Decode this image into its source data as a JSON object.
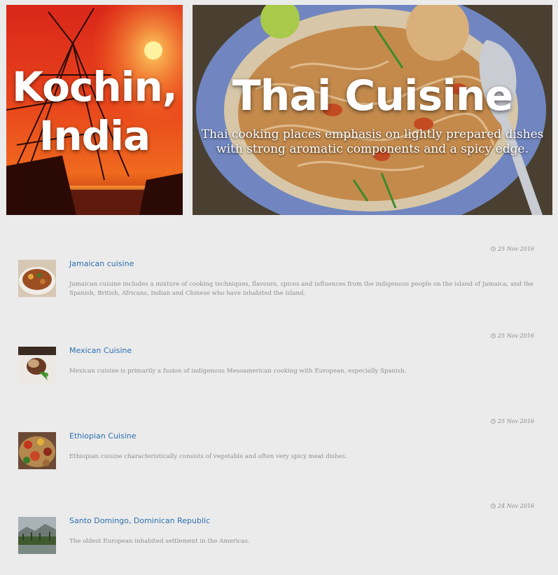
{
  "heroes": {
    "kochin": {
      "title": "Kochin, India"
    },
    "thai": {
      "title": "Thai Cuisine",
      "description": "Thai cooking places emphasis on lightly prepared dishes with strong aromatic components and a spicy edge."
    }
  },
  "articles": [
    {
      "title": "Jamaican cuisine",
      "date": "25 Nov 2016",
      "summary": "Jamaican cuisine includes a mixture of cooking techniques, flavours, spices and influences from the indigenous people on the island of Jamaica, and the Spanish, British, Africans, Indian and Chinese who have inhabited the island.",
      "thumbnail": "jamaican-soup-thumbnail"
    },
    {
      "title": "Mexican Cuisine",
      "date": "25 Nov 2016",
      "summary": "Mexican cuisine is primarily a fusion of indigenous Mesoamerican cooking with European, especially Spanish.",
      "thumbnail": "mexican-dish-thumbnail"
    },
    {
      "title": "Ethiopian Cuisine",
      "date": "25 Nov 2016",
      "summary": "Ethiopian cuisine characteristically consists of vegetable and often very spicy meat dishes.",
      "thumbnail": "ethiopian-platter-thumbnail"
    },
    {
      "title": "Santo Domingo, Dominican Republic",
      "date": "24 Nov 2016",
      "summary": "The oldest European inhabited settlement in the Americas.",
      "thumbnail": "santo-domingo-landscape-thumbnail"
    }
  ],
  "icons": {
    "date": "clock-icon"
  },
  "colors": {
    "page_background": "#ebebeb",
    "link": "#2a6fb0",
    "muted_text": "#8e8e8e",
    "hero_text": "#ffffff"
  }
}
